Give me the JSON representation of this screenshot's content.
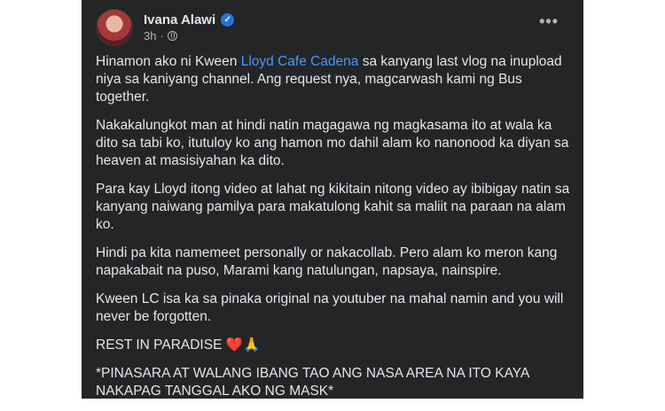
{
  "post": {
    "author": "Ivana Alawi",
    "time": "3h",
    "verified_icon": "verified-badge-icon",
    "audience_icon": "globe-icon",
    "more_label": "•••",
    "paragraphs": [
      {
        "before": "Hinamon ako ni Kween ",
        "mention": "Lloyd Cafe Cadena",
        "after": " sa kanyang last vlog na inupload niya sa kaniyang channel. Ang request nya, magcarwash kami ng Bus together."
      },
      "Nakakalungkot man at hindi natin magagawa ng magkasama ito at wala ka dito sa tabi ko, itutuloy ko ang hamon mo dahil alam ko nanonood ka diyan sa heaven at masisiyahan ka dito.",
      "Para kay Lloyd itong video at lahat ng kikitain nitong video ay ibibigay natin sa kanyang naiwang pamilya para makatulong kahit sa maliit na paraan na alam ko.",
      "Hindi pa kita namemeet personally or nakacollab. Pero alam ko meron kang napakabait na puso, Marami kang natulungan, napsaya, nainspire.",
      "Kween LC isa ka sa pinaka original na youtuber na mahal namin and you will never be forgotten.",
      {
        "text": "REST IN PARADISE",
        "emoji1": "❤️",
        "emoji2": "🙏"
      },
      "*PINASARA AT WALANG IBANG TAO ANG NASA AREA NA ITO KAYA NAKAPAG TANGGAL AKO NG MASK*"
    ]
  },
  "colors": {
    "card_bg": "#242526",
    "text": "#e4e6eb",
    "secondary": "#b0b3b8",
    "link": "#4599ff",
    "verified": "#2374e1"
  }
}
